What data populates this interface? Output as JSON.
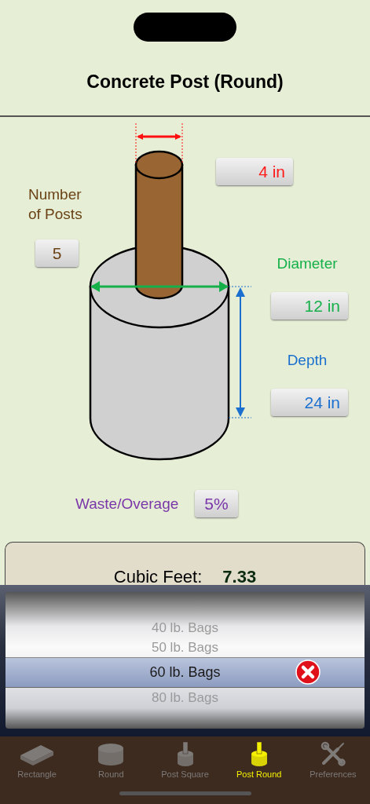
{
  "title": "Concrete Post (Round)",
  "post_width": {
    "value": "4 in"
  },
  "posts": {
    "label": "Number of Posts",
    "value": "5"
  },
  "diameter": {
    "label": "Diameter",
    "value": "12 in"
  },
  "depth": {
    "label": "Depth",
    "value": "24 in"
  },
  "waste": {
    "label": "Waste/Overage",
    "value": "5%"
  },
  "result": {
    "label": "Cubic Feet:",
    "value": "7.33"
  },
  "picker": {
    "options": [
      {
        "label": "40 lb. Bags",
        "selected": false
      },
      {
        "label": "50 lb. Bags",
        "selected": false
      },
      {
        "label": "60 lb. Bags",
        "selected": true
      },
      {
        "label": "80 lb. Bags",
        "selected": false
      }
    ]
  },
  "tabs": [
    {
      "label": "Rectangle",
      "kind": "block",
      "selected": false
    },
    {
      "label": "Round",
      "kind": "drum",
      "selected": false
    },
    {
      "label": "Post Square",
      "kind": "post",
      "selected": false
    },
    {
      "label": "Post Round",
      "kind": "post",
      "selected": true
    },
    {
      "label": "Preferences",
      "kind": "tools",
      "selected": false
    }
  ]
}
